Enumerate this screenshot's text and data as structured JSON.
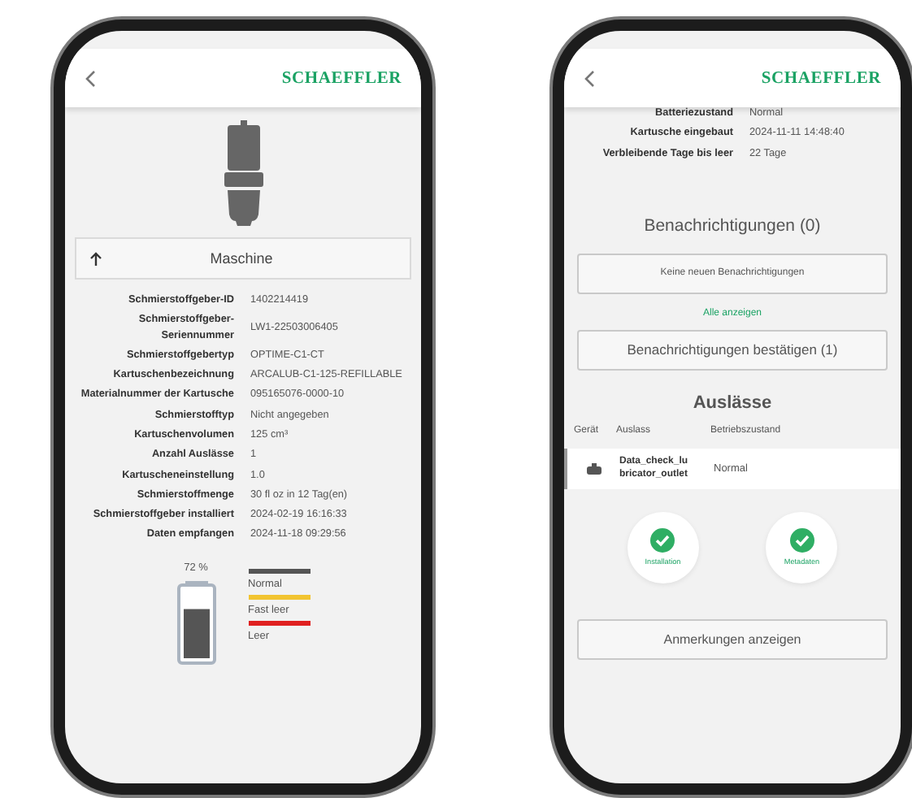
{
  "left_screen": {
    "logo": "SCHAEFFLER",
    "section": {
      "title": "Maschine",
      "expanded": true
    },
    "details": [
      {
        "label": "Schmierstoffgeber-ID",
        "value": "1402214419"
      },
      {
        "label": "Schmierstoffgeber-Seriennummer",
        "value": "LW1-22503006405"
      },
      {
        "label": "Schmierstoffgebertyp",
        "value": "OPTIME-C1-CT"
      },
      {
        "label": "Kartuschenbezeichnung",
        "value": "ARCALUB-C1-125-REFILLABLE"
      },
      {
        "label": "Materialnummer der Kartusche",
        "value": "095165076-0000-10"
      },
      {
        "label": "Schmierstofftyp",
        "value": "Nicht angegeben"
      },
      {
        "label": "Kartuschenvolumen",
        "value": "125 cm³"
      },
      {
        "label": "Anzahl Auslässe",
        "value": "1"
      },
      {
        "label": "Kartuscheneinstellung",
        "value": "1.0"
      },
      {
        "label": "Schmierstoffmenge",
        "value": "30 fl oz in 12 Tag(en)"
      },
      {
        "label": "Schmierstoffgeber installiert",
        "value": "2024-02-19 16:16:33"
      },
      {
        "label": "Daten empfangen",
        "value": "2024-11-18 09:29:56"
      }
    ],
    "battery": {
      "reading": "72 %",
      "level": 0.72
    },
    "legend": [
      {
        "label": "Normal",
        "color": "#555555"
      },
      {
        "label": "Fast leer",
        "color": "#f2c431"
      },
      {
        "label": "Leer",
        "color": "#e02020"
      }
    ]
  },
  "right_screen": {
    "logo": "SCHAEFFLER",
    "details": [
      {
        "label": "Batteriezustand",
        "value": "Normal"
      },
      {
        "label": "Kartusche eingebaut",
        "value": "2024-11-11 14:48:40"
      },
      {
        "label": "Verbleibende Tage bis leer",
        "value": "22 Tage"
      }
    ],
    "notifications": {
      "title": "Benachrichtigungen (0)",
      "message": "Keine neuen Benachrichtigungen",
      "link": "Alle anzeigen",
      "confirm_button": "Benachrichtigungen bestätigen (1)"
    },
    "outlets": {
      "title": "Auslässe",
      "columns": [
        "Gerät",
        "Auslass",
        "Betriebszustand"
      ],
      "rows": [
        {
          "outlet": "Data_check_lubricator_outlet",
          "status": "Normal"
        }
      ]
    },
    "status_tiles": [
      {
        "label": "Installation",
        "done": true
      },
      {
        "label": "Metadaten",
        "done": true
      }
    ],
    "notes_button": "Anmerkungen anzeigen"
  }
}
